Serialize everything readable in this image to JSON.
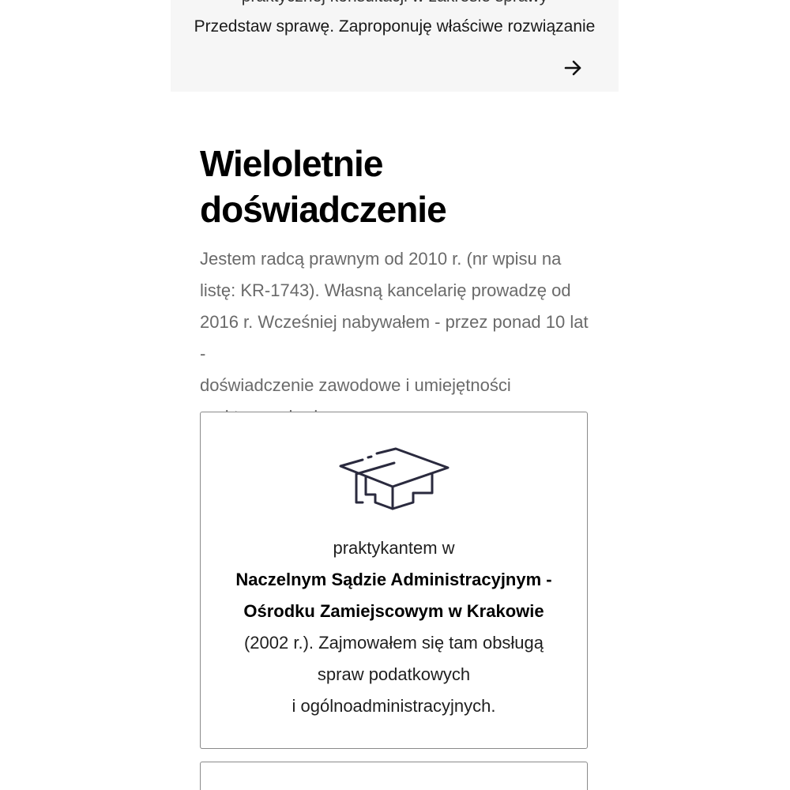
{
  "cta": {
    "partial_text_above": "praktycznej konsultacji w zakresie sprawy",
    "text": "Przedstaw sprawę. Zaproponuję właściwe rozwiązanie",
    "arrow_icon": "arrow-right-icon"
  },
  "section": {
    "heading_line1": "Wieloletnie",
    "heading_line2": "doświadczenie",
    "intro_line1": "Jestem radcą prawnym od 2010 r. (nr wpisu na",
    "intro_line2": "listę: KR-1743). Własną kancelarię prowadzę od",
    "intro_line3": "2016 r. Wcześniej nabywałem - przez ponad 10 lat -",
    "intro_line4": "doświadczenie zawodowe i umiejętności",
    "intro_line5": "praktyczne będąc:"
  },
  "cards": [
    {
      "icon": "graduation-cap-icon",
      "icon_color": "#2a2a3e",
      "line1": "praktykantem w",
      "bold_line1": "Naczelnym Sądzie Administracyjnym -",
      "bold_line2": "Ośrodku Zamiejscowym w Krakowie",
      "line2": "(2002 r.). Zajmowałem się tam obsługą",
      "line3": "spraw podatkowych",
      "line4": "i ogólnoadministracyjnych."
    }
  ]
}
